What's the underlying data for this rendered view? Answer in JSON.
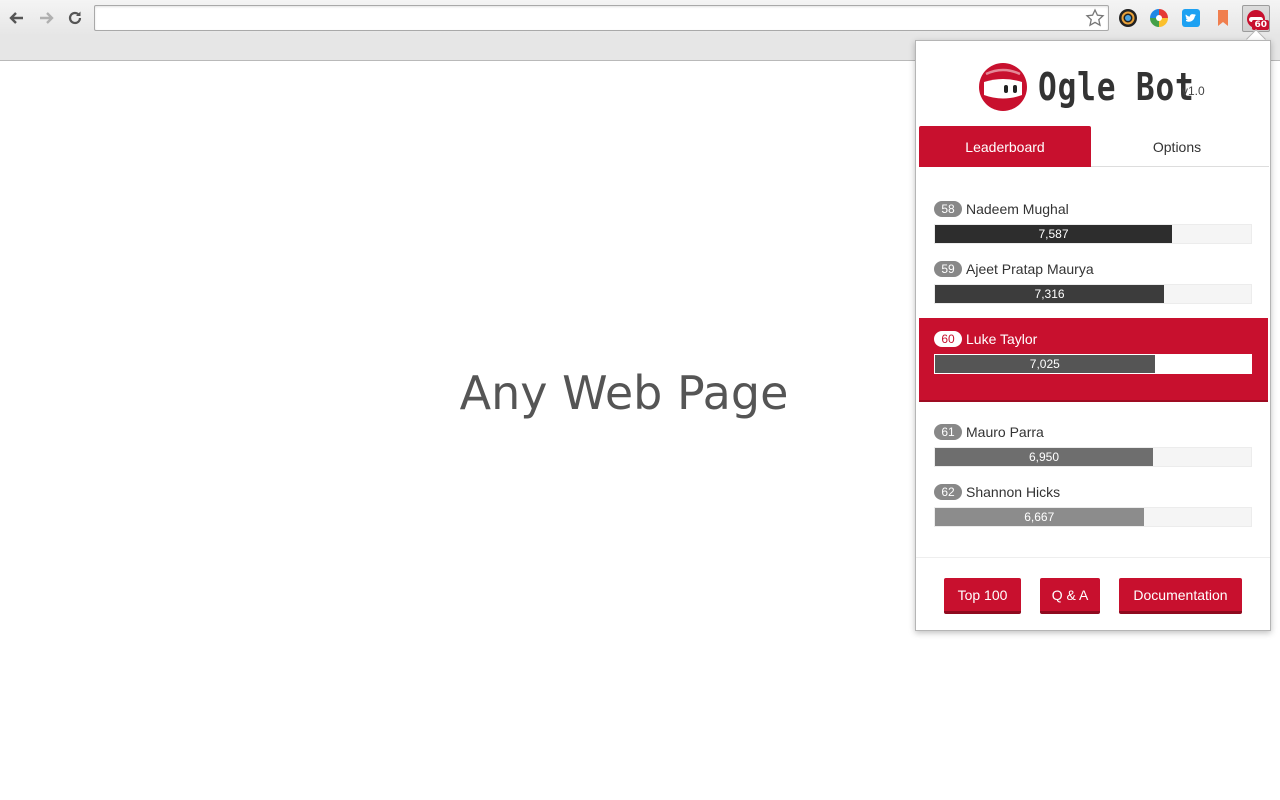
{
  "browser": {
    "address_value": "",
    "extensions": [
      "color-wheel-icon",
      "color-picker-icon",
      "twitter-icon",
      "bookmark-ribbon-icon",
      "ogle-bot-icon"
    ],
    "active_extension_badge": "60"
  },
  "page": {
    "heading": "Any Web Page"
  },
  "popup": {
    "title": "Ogle Bot",
    "version": "v1.0",
    "tabs": [
      {
        "label": "Leaderboard",
        "active": true
      },
      {
        "label": "Options",
        "active": false
      }
    ],
    "leaderboard": [
      {
        "rank": "58",
        "name": "Nadeem Mughal",
        "score": "7,587",
        "fill": 0.75,
        "color": "#2d2d2d",
        "highlighted": false
      },
      {
        "rank": "59",
        "name": "Ajeet Pratap Maurya",
        "score": "7,316",
        "fill": 0.725,
        "color": "#3c3c3c",
        "highlighted": false
      },
      {
        "rank": "60",
        "name": "Luke Taylor",
        "score": "7,025",
        "fill": 0.695,
        "color": "#555555",
        "highlighted": true
      },
      {
        "rank": "61",
        "name": "Mauro Parra",
        "score": "6,950",
        "fill": 0.69,
        "color": "#6e6e6e",
        "highlighted": false
      },
      {
        "rank": "62",
        "name": "Shannon Hicks",
        "score": "6,667",
        "fill": 0.66,
        "color": "#8c8c8c",
        "highlighted": false
      }
    ],
    "buttons": [
      {
        "label": "Top 100"
      },
      {
        "label": "Q & A"
      },
      {
        "label": "Documentation"
      }
    ],
    "accent_color": "#c8102e"
  }
}
